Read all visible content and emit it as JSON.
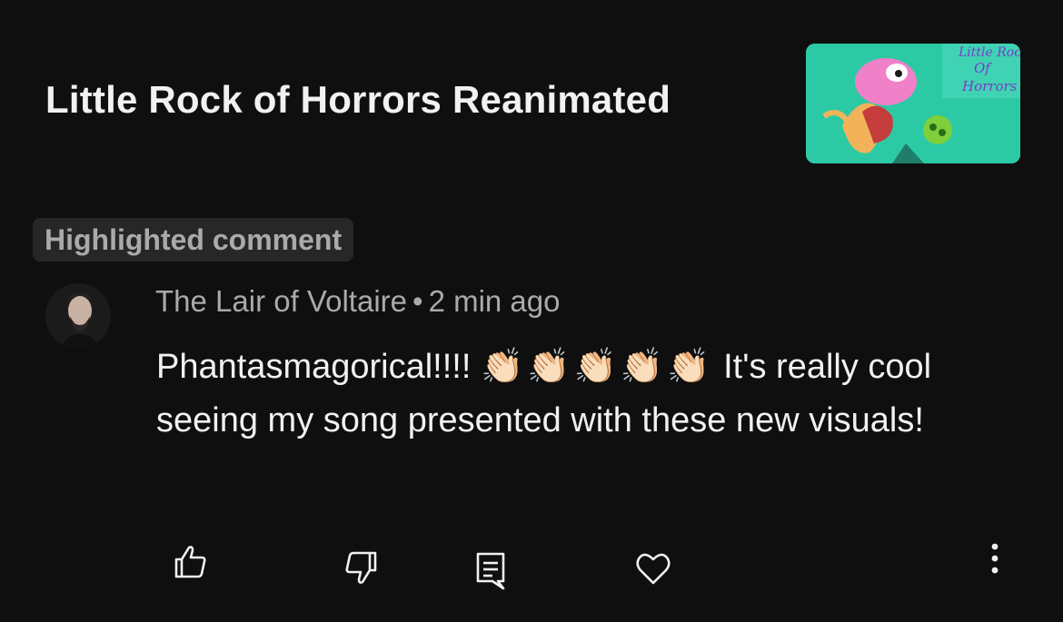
{
  "video": {
    "title": "Little Rock of Horrors Reanimated",
    "thumbnail_icon": "cartoon-thumbnail",
    "thumbnail_text_lines": [
      "Little Rock",
      "Of",
      "Horrors"
    ]
  },
  "badge": {
    "label": "Highlighted comment"
  },
  "comment": {
    "author": "The Lair of Voltaire",
    "separator": "•",
    "time": "2 min ago",
    "text_before": "Phantasmagorical!!!!",
    "emoji": "👏🏻👏🏻👏🏻👏🏻👏🏻",
    "text_after": "It's really cool seeing my song presented with these new visuals!"
  },
  "actions": {
    "icons": [
      "thumbs-up-icon",
      "thumbs-down-icon",
      "reply-icon",
      "heart-icon",
      "more-vert-icon"
    ]
  },
  "colors": {
    "background": "#0f0f0f",
    "primary_text": "#f1f1f1",
    "secondary_text": "#aaaaaa",
    "badge_background": "#272727"
  }
}
